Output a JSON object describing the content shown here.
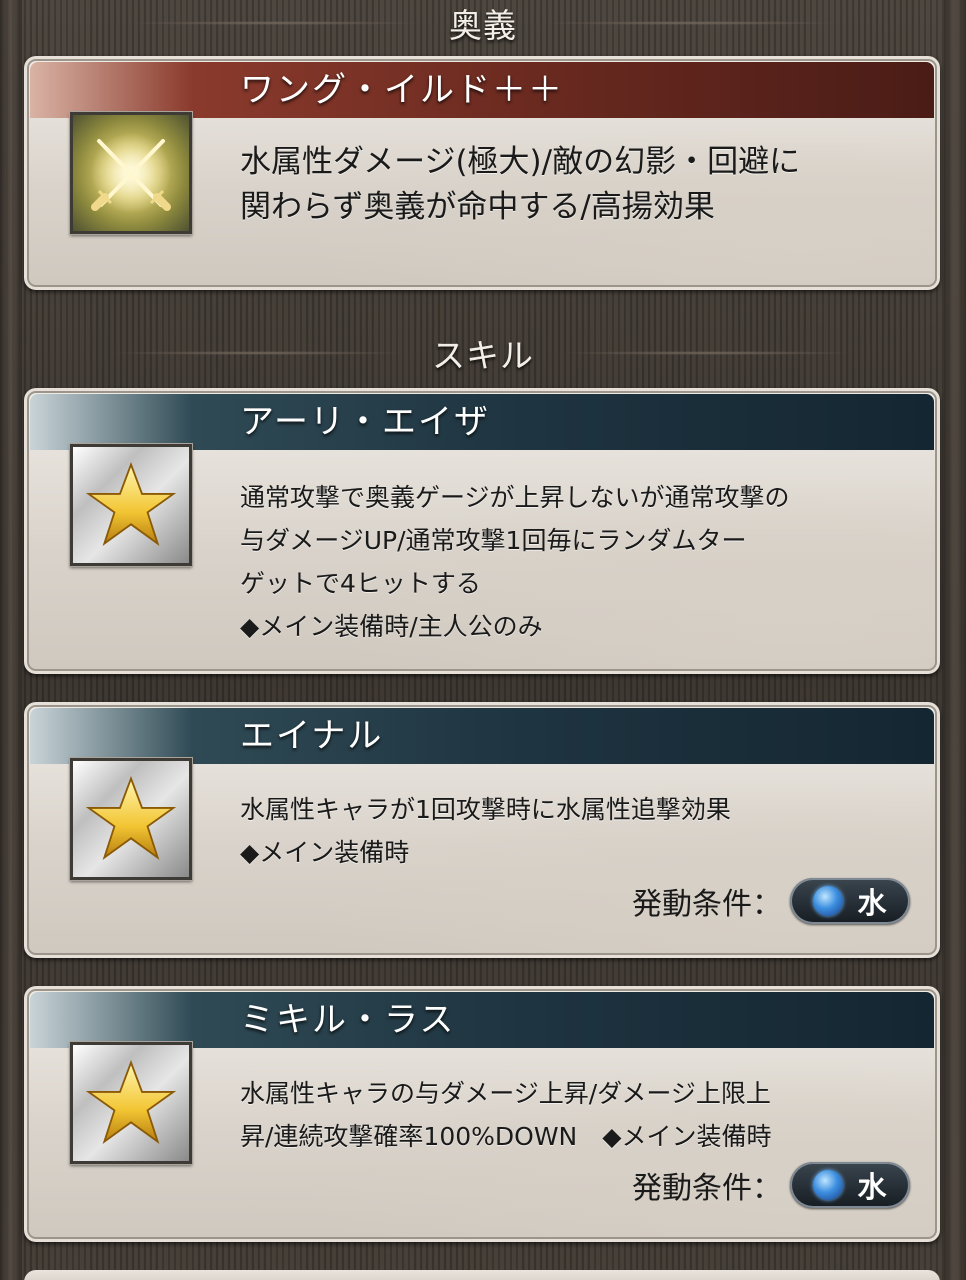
{
  "ougi_section": {
    "title": "奥義",
    "card": {
      "name": "ワング・イルド＋＋",
      "icon": "crossed-swords-icon",
      "description": [
        "水属性ダメージ(極大)/敵の幻影・回避に",
        "関わらず奥義が命中する/高揚効果"
      ]
    }
  },
  "skill_section": {
    "title": "スキル",
    "cards": [
      {
        "name": "アーリ・エイザ",
        "icon": "star-icon",
        "description": [
          "通常攻撃で奥義ゲージが上昇しないが通常攻撃の",
          "与ダメージUP/通常攻撃1回毎にランダムター",
          "ゲットで4ヒットする",
          "◆メイン装備時/主人公のみ"
        ]
      },
      {
        "name": "エイナル",
        "icon": "star-icon",
        "description": [
          "水属性キャラが1回攻撃時に水属性追撃効果",
          "◆メイン装備時"
        ],
        "condition_label": "発動条件：",
        "condition_element": "水"
      },
      {
        "name": "ミキル・ラス",
        "icon": "star-icon",
        "description": [
          "水属性キャラの与ダメージ上昇/ダメージ上限上",
          "昇/連続攻撃確率100%DOWN　◆メイン装備時"
        ],
        "condition_label": "発動条件：",
        "condition_element": "水"
      }
    ]
  },
  "colors": {
    "ougi_header": "#6b2a20",
    "skill_header": "#1e3440",
    "water_element": "#3d8fe0"
  }
}
